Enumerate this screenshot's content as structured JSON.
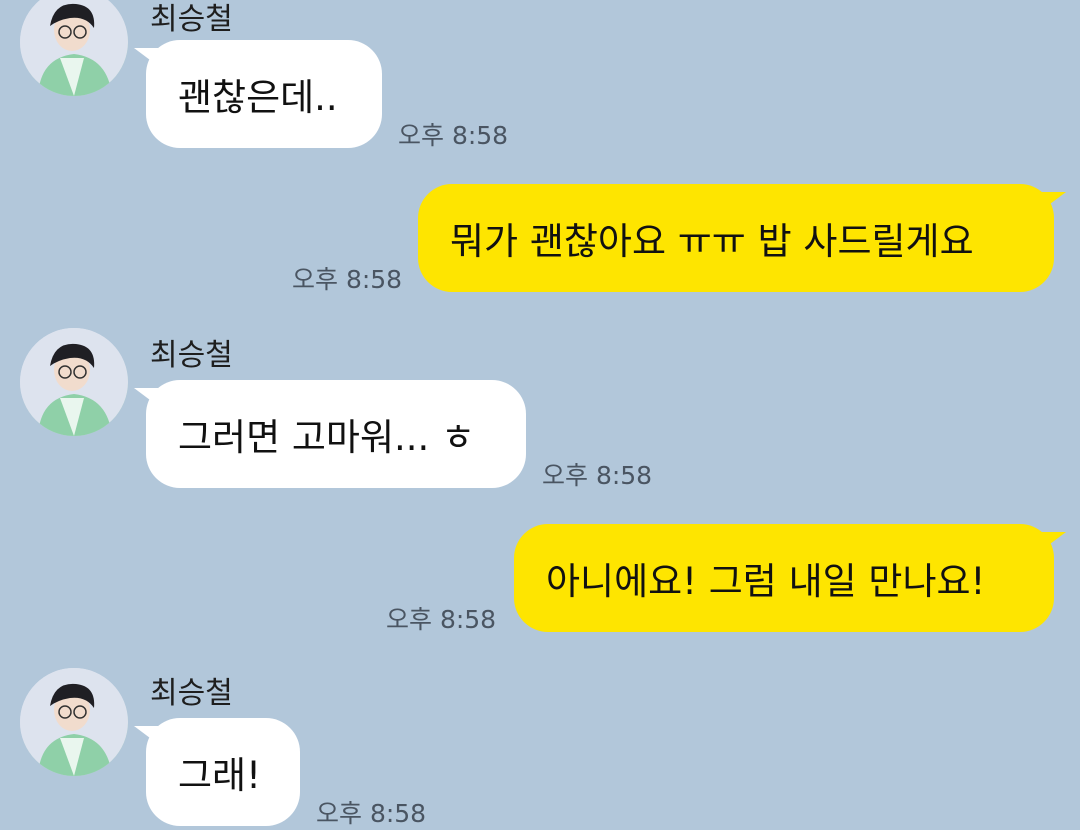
{
  "messages": [
    {
      "side": "in",
      "sender": "최승철",
      "text": "괜찮은데..",
      "time": "오후 8:58"
    },
    {
      "side": "out",
      "text": "뭐가 괜찮아요 ㅠㅠ 밥 사드릴게요",
      "time": "오후 8:58"
    },
    {
      "side": "in",
      "sender": "최승철",
      "text": "그러면 고마워... ㅎ",
      "time": "오후 8:58"
    },
    {
      "side": "out",
      "text": "아니에요! 그럼 내일 만나요!",
      "time": "오후 8:58"
    },
    {
      "side": "in",
      "sender": "최승철",
      "text": "그래!",
      "time": "오후 8:58"
    }
  ],
  "colors": {
    "background": "#b2c7da",
    "incoming_bubble": "#ffffff",
    "outgoing_bubble": "#fee500"
  },
  "icons": {
    "avatar": "profile-photo"
  }
}
